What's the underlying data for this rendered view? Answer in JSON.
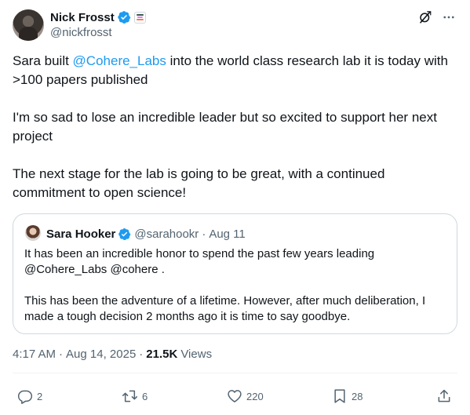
{
  "author": {
    "display_name": "Nick Frosst",
    "handle": "@nickfrosst",
    "verified": true,
    "org_badge_icon": "cohere-affiliate-badge"
  },
  "header_icons": [
    "grok-icon",
    "more-icon"
  ],
  "tweet": {
    "paragraph1_before": "Sara built ",
    "paragraph1_mention": "@Cohere_Labs",
    "paragraph1_after": " into the world class research lab it is today with >100 papers published",
    "paragraph2": "I'm so sad to lose an incredible leader but so excited to support her next project",
    "paragraph3": "The next stage for the lab is going to be great, with a continued commitment to open science!"
  },
  "quote": {
    "display_name": "Sara Hooker",
    "handle": "@sarahookr",
    "separator": "·",
    "date": "Aug 11",
    "paragraph1": "It has been an incredible honor to spend the past few years leading @Cohere_Labs @cohere .",
    "paragraph2": "This has been the adventure of a lifetime. However, after much deliberation, I made a tough decision 2 months ago it is time to say goodbye."
  },
  "meta": {
    "time": "4:17 AM",
    "sep1": "·",
    "date": "Aug 14, 2025",
    "sep2": "·",
    "views_count": "21.5K",
    "views_label": "Views"
  },
  "actions": {
    "replies": "2",
    "reposts": "6",
    "likes": "220",
    "bookmarks": "28"
  },
  "colors": {
    "accent": "#1d9bf0",
    "text_primary": "#0f1419",
    "text_secondary": "#536471",
    "border": "#cfd9de"
  }
}
